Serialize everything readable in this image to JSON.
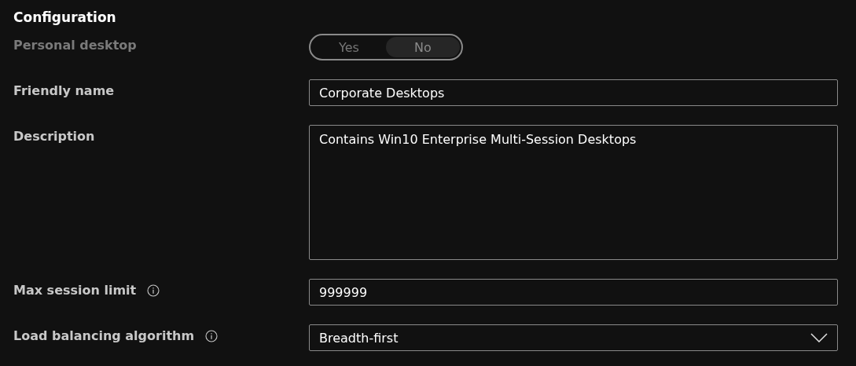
{
  "section": {
    "title": "Configuration"
  },
  "fields": [
    {
      "kind": "toggle",
      "label": "Personal desktop",
      "disabled": true,
      "options": [
        {
          "label": "Yes",
          "selected": false
        },
        {
          "label": "No",
          "selected": true
        }
      ]
    },
    {
      "kind": "text",
      "label": "Friendly name",
      "value": "Corporate Desktops"
    },
    {
      "kind": "textarea",
      "label": "Description",
      "value": "Contains Win10 Enterprise Multi-Session Desktops"
    },
    {
      "kind": "text",
      "label": "Max session limit",
      "info": true,
      "value": "999999"
    },
    {
      "kind": "dropdown",
      "label": "Load balancing algorithm",
      "info": true,
      "value": "Breadth-first"
    }
  ]
}
